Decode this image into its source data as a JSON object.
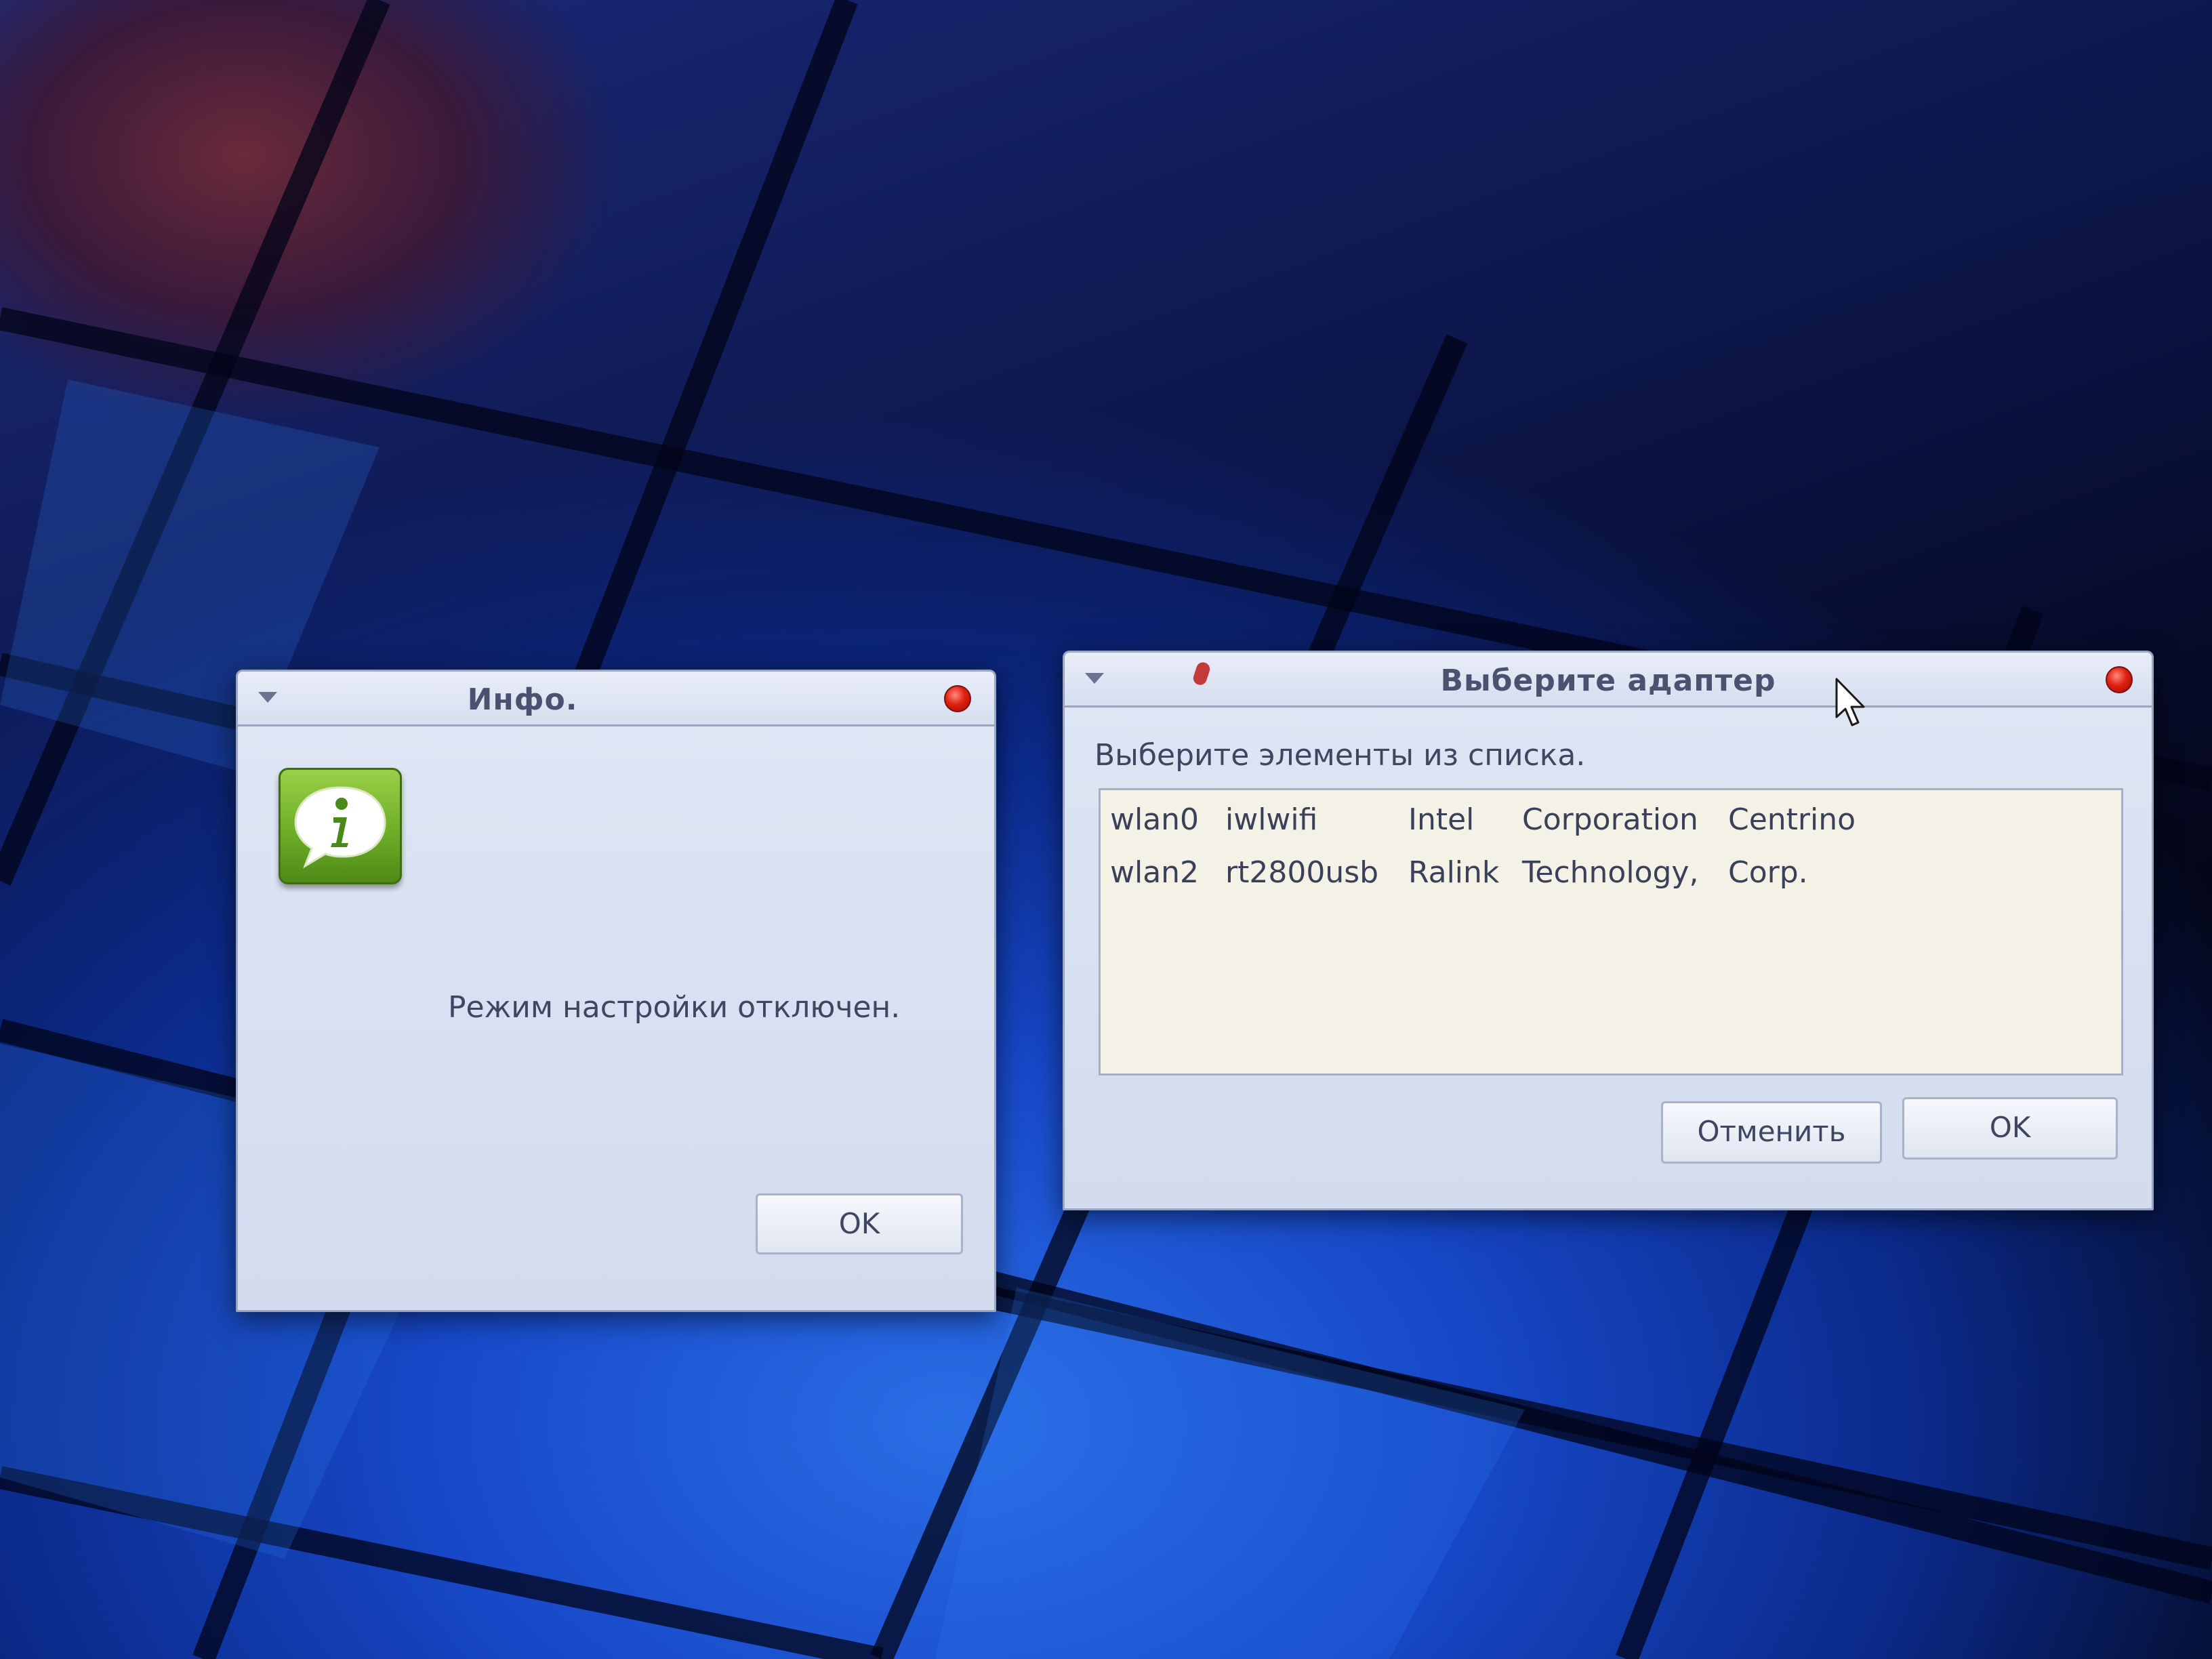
{
  "info_dialog": {
    "title": "Инфо.",
    "message": "Режим настройки отключен.",
    "ok_label": "OK",
    "icon": "info-speech-bubble-icon"
  },
  "adapter_dialog": {
    "title": "Выберите адаптер",
    "prompt": "Выберите элементы из списка.",
    "rows": [
      {
        "iface": "wlan0",
        "driver": "iwlwifi",
        "c1": "Intel",
        "c2": "Corporation",
        "c3": "Centrino"
      },
      {
        "iface": "wlan2",
        "driver": "rt2800usb",
        "c1": "Ralink",
        "c2": "Technology,",
        "c3": "Corp."
      }
    ],
    "cancel_label": "Отменить",
    "ok_label": "OK"
  },
  "colors": {
    "close_button": "#e02010",
    "window_bg": "#d2dcee",
    "list_bg": "#f4f1e6"
  }
}
